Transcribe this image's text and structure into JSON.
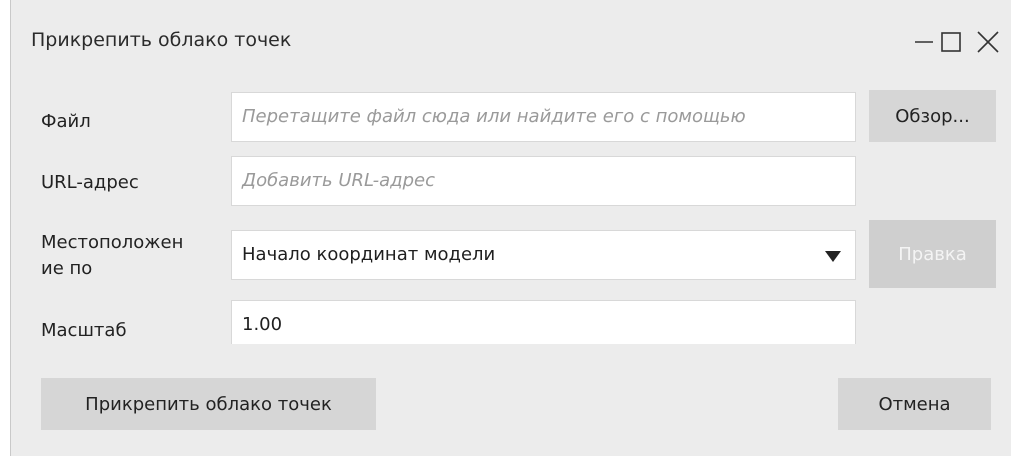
{
  "window": {
    "title": "Прикрепить облако точек",
    "controls": [
      "minimize-icon",
      "maximize-icon",
      "close-icon"
    ]
  },
  "form": {
    "file": {
      "label": "Файл",
      "placeholder": "Перетащите файл сюда или найдите его с помощью",
      "browse_label": "Обзор..."
    },
    "url": {
      "label": "URL-адрес",
      "placeholder": "Добавить URL-адрес"
    },
    "position": {
      "label_line1": "Местоположен",
      "label_line2": "ие по",
      "selected": "Начало координат модели",
      "edit_label": "Правка"
    },
    "scale": {
      "label": "Масштаб",
      "value": "1.00"
    }
  },
  "footer": {
    "attach_label": "Прикрепить облако точек",
    "cancel_label": "Отмена"
  }
}
